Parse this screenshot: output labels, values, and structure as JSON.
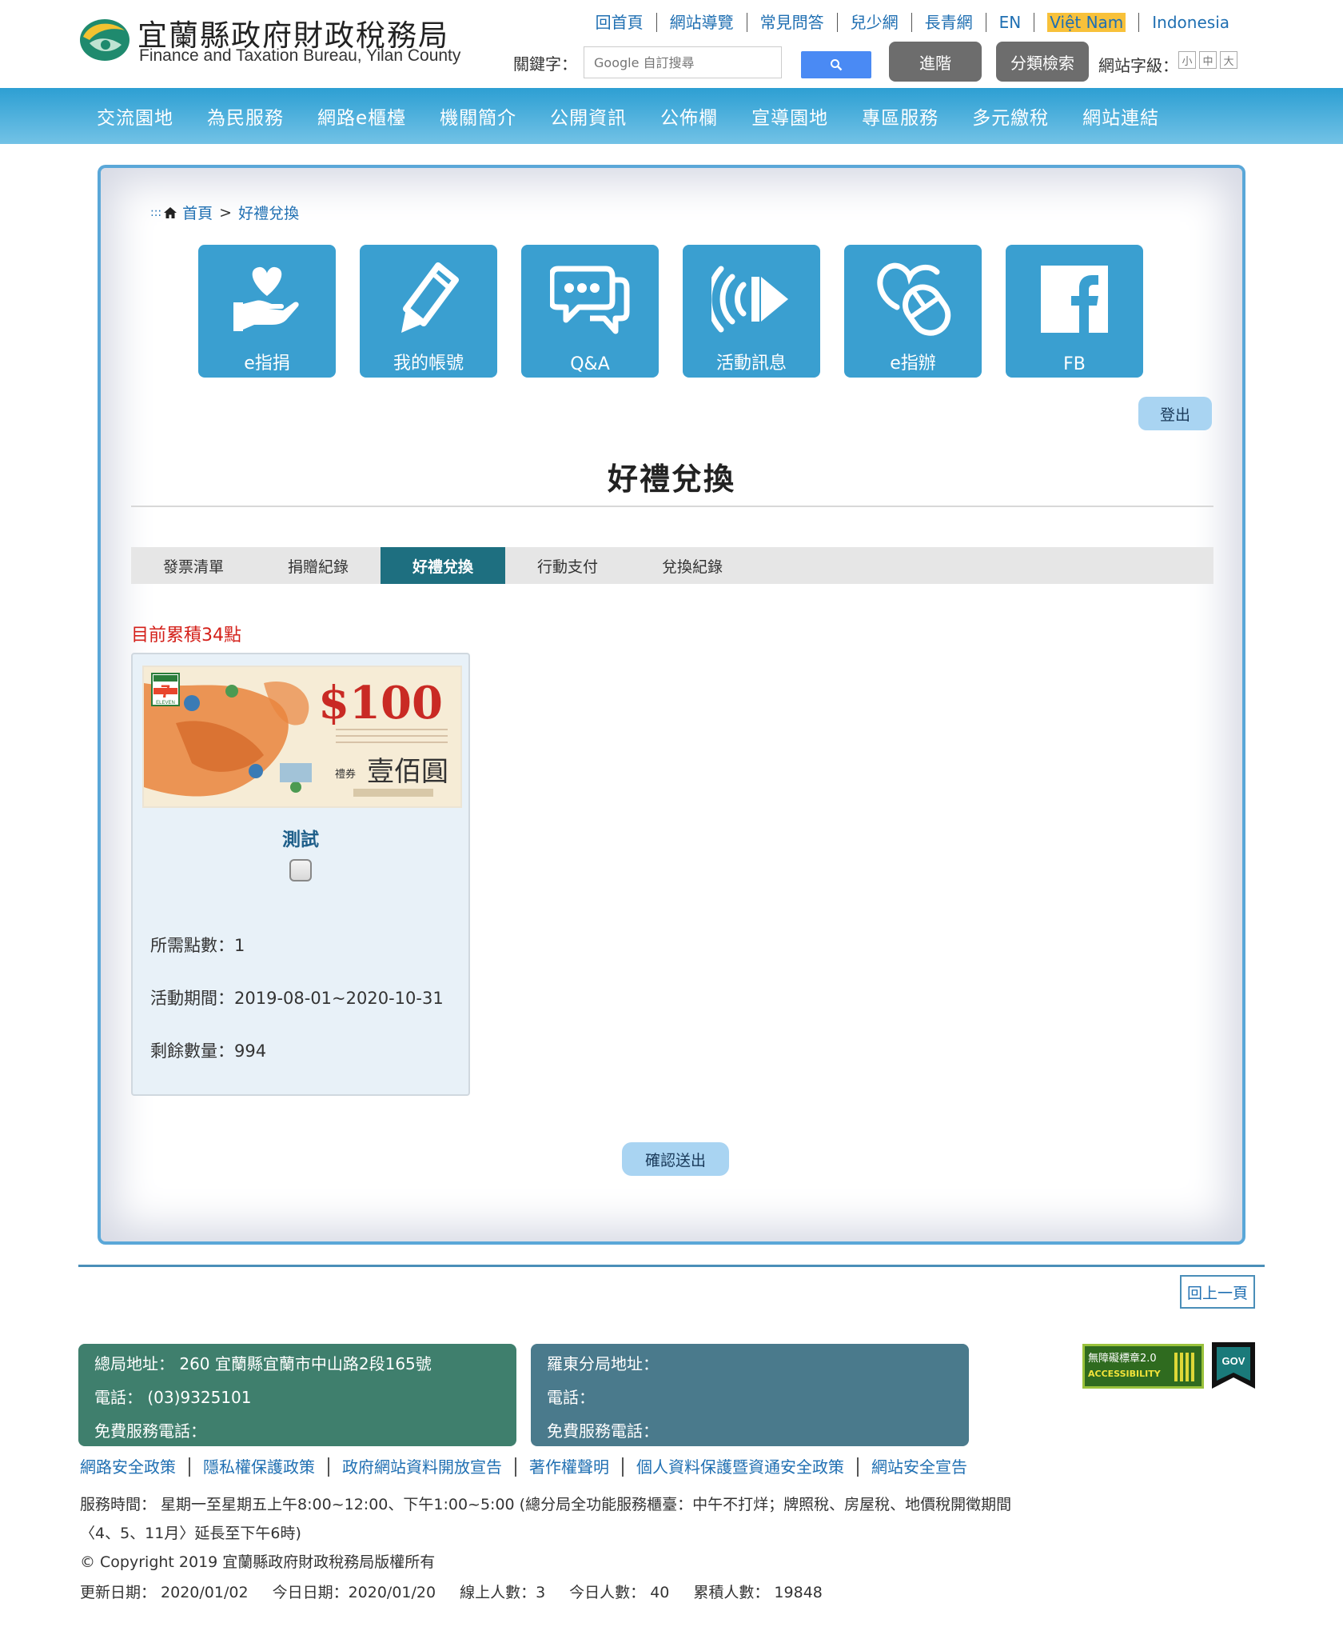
{
  "header": {
    "logo_zh": "宜蘭縣政府財政稅務局",
    "logo_en": "Finance and Taxation Bureau, Yilan County",
    "top_links": [
      "回首頁",
      "網站導覽",
      "常見問答",
      "兒少網",
      "長青網",
      "EN",
      "Việt Nam",
      "Indonesia"
    ],
    "search": {
      "label": "關鍵字：",
      "placeholder": "Google 自訂搜尋",
      "submit_icon": "search-icon",
      "accent": "#4a8af4"
    },
    "advanced_label": "進階",
    "category_label": "分類檢索",
    "font_size_label": "網站字級：",
    "font_sizes": [
      "小",
      "中",
      "大"
    ]
  },
  "nav": {
    "items": [
      "交流園地",
      "為民服務",
      "網路e櫃檯",
      "機關簡介",
      "公開資訊",
      "公佈欄",
      "宣導園地",
      "專區服務",
      "多元繳稅",
      "網站連結"
    ]
  },
  "breadcrumb": {
    "dots": ":::",
    "home": "首頁",
    "sep": ">",
    "current": "好禮兌換"
  },
  "tiles": [
    {
      "label": "e指捐",
      "icon": "heart-hand-icon"
    },
    {
      "label": "我的帳號",
      "icon": "pencil-icon"
    },
    {
      "label": "Q&A",
      "icon": "chat-bubbles-icon"
    },
    {
      "label": "活動訊息",
      "icon": "speaker-icon"
    },
    {
      "label": "e指辦",
      "icon": "mouse-icon"
    },
    {
      "label": "FB",
      "icon": "facebook-icon"
    }
  ],
  "logout_label": "登出",
  "page_title": "好禮兌換",
  "tabs": [
    {
      "label": "發票清單",
      "active": false
    },
    {
      "label": "捐贈紀錄",
      "active": false
    },
    {
      "label": "好禮兌換",
      "active": true
    },
    {
      "label": "行動支付",
      "active": false
    },
    {
      "label": "兌換紀錄",
      "active": false
    }
  ],
  "points_text": "目前累積34點",
  "gift": {
    "voucher": {
      "brand": "ELEVEN",
      "amount": "$100",
      "label_small": "禮券",
      "label_large": "壹佰圓"
    },
    "name": "測試",
    "checked": false,
    "required_points": "所需點數：1",
    "period": "活動期間：2019-08-01~2020-10-31",
    "remaining": "剩餘數量：994"
  },
  "confirm_label": "確認送出",
  "footer": {
    "back_label": "回上一頁",
    "main_office": [
      "總局地址： 260 宜蘭縣宜蘭市中山路2段165號",
      "電話： (03)9325101",
      "免費服務電話："
    ],
    "branch_office": [
      "羅東分局地址：",
      "電話：",
      "免費服務電話："
    ],
    "accessibility_badge": {
      "line1": "無障礙標章2.0",
      "line2": "ACCESSIBILITY"
    },
    "gov_badge": "GOV",
    "policy_links": [
      "網路安全政策",
      "隱私權保護政策",
      "政府網站資料開放宣告",
      "著作權聲明",
      "個人資料保護暨資通安全政策",
      "網站安全宣告"
    ],
    "service_hours_1": "服務時間： 星期一至星期五上午8:00~12:00、下午1:00~5:00 (總分局全功能服務櫃臺：中午不打烊；牌照稅、房屋稅、地價稅開徵期間",
    "service_hours_2": "〈4、5、11月〉延長至下午6時)",
    "copyright": "© Copyright 2019 宜蘭縣政府財政稅務局版權所有",
    "stats": [
      "更新日期： 2020/01/02",
      "今日日期：2020/01/20",
      "線上人數：3",
      "今日人數： 40",
      "累積人數： 19848"
    ]
  }
}
